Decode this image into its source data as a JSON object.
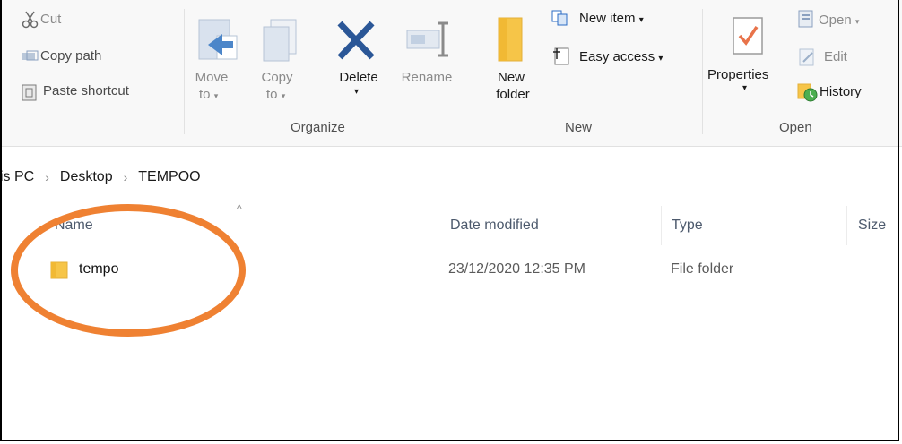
{
  "ribbon": {
    "clipboard": {
      "cut": "Cut",
      "copy_path": "Copy path",
      "paste_shortcut": "Paste shortcut"
    },
    "organize": {
      "move_to": "Move",
      "move_to_2": "to",
      "copy_to": "Copy",
      "copy_to_2": "to",
      "delete": "Delete",
      "rename": "Rename",
      "group_label": "Organize"
    },
    "new": {
      "new_folder": "New",
      "new_folder_2": "folder",
      "new_item": "New item",
      "easy_access": "Easy access",
      "group_label": "New"
    },
    "open": {
      "properties": "Properties",
      "open": "Open",
      "edit": "Edit",
      "history": "History",
      "group_label": "Open"
    }
  },
  "address": {
    "crumbs": [
      "is PC",
      "Desktop",
      "TEMPOO"
    ]
  },
  "file_list": {
    "columns": [
      "Name",
      "Date modified",
      "Type",
      "Size"
    ],
    "rows": [
      {
        "name": "tempo",
        "date_modified": "23/12/2020 12:35 PM",
        "type": "File folder",
        "size": ""
      }
    ]
  },
  "colors": {
    "highlight": "#ef8132",
    "folder": "#f6c548",
    "accent_blue": "#2b6cc4",
    "delete_x": "#2b5797"
  },
  "icons": [
    "scissors-icon",
    "copy-path-icon",
    "paste-shortcut-icon",
    "move-to-icon",
    "copy-to-icon",
    "delete-icon",
    "rename-icon",
    "new-folder-icon",
    "new-item-icon",
    "easy-access-icon",
    "properties-icon",
    "open-icon",
    "edit-icon",
    "history-icon",
    "folder-icon",
    "sort-up-icon"
  ]
}
